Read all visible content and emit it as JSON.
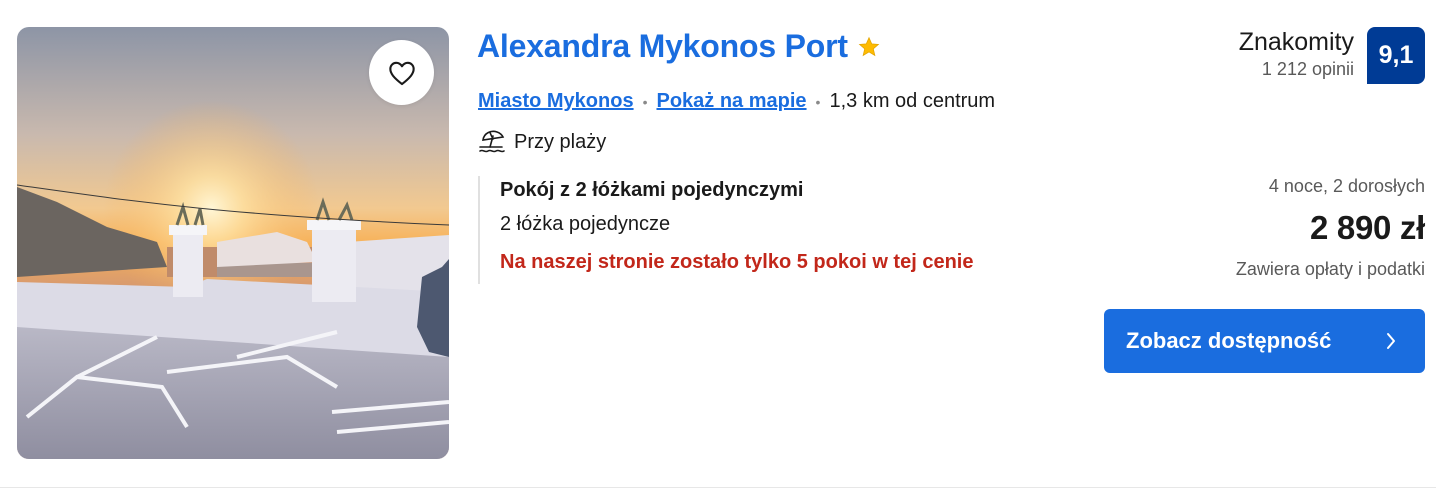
{
  "hotel": {
    "name": "Alexandra Mykonos Port",
    "stars": 1,
    "location_link": "Miasto Mykonos",
    "map_link": "Pokaż na mapie",
    "separator": "•",
    "distance": "1,3 km od centrum",
    "beach_label": "Przy plaży"
  },
  "review": {
    "word": "Znakomity",
    "count": "1 212 opinii",
    "score": "9,1"
  },
  "room": {
    "title": "Pokój z 2 łóżkami pojedynczymi",
    "beds": "2 łóżka pojedyncze",
    "scarcity": "Na naszej stronie zostało tylko 5 pokoi w tej cenie"
  },
  "price": {
    "stay_info": "4 noce, 2 dorosłych",
    "amount": "2 890 zł",
    "tax_note": "Zawiera opłaty i podatki"
  },
  "cta": {
    "label": "Zobacz dostępność"
  },
  "icons": {
    "favorite": "heart-icon",
    "star": "star-icon",
    "beach": "beach-umbrella-icon",
    "chevron": "chevron-right-icon"
  },
  "colors": {
    "link": "#1a6ddf",
    "score_bg": "#003b95",
    "scarcity": "#c2271a",
    "star": "#febb02",
    "button": "#1a6ddf"
  }
}
